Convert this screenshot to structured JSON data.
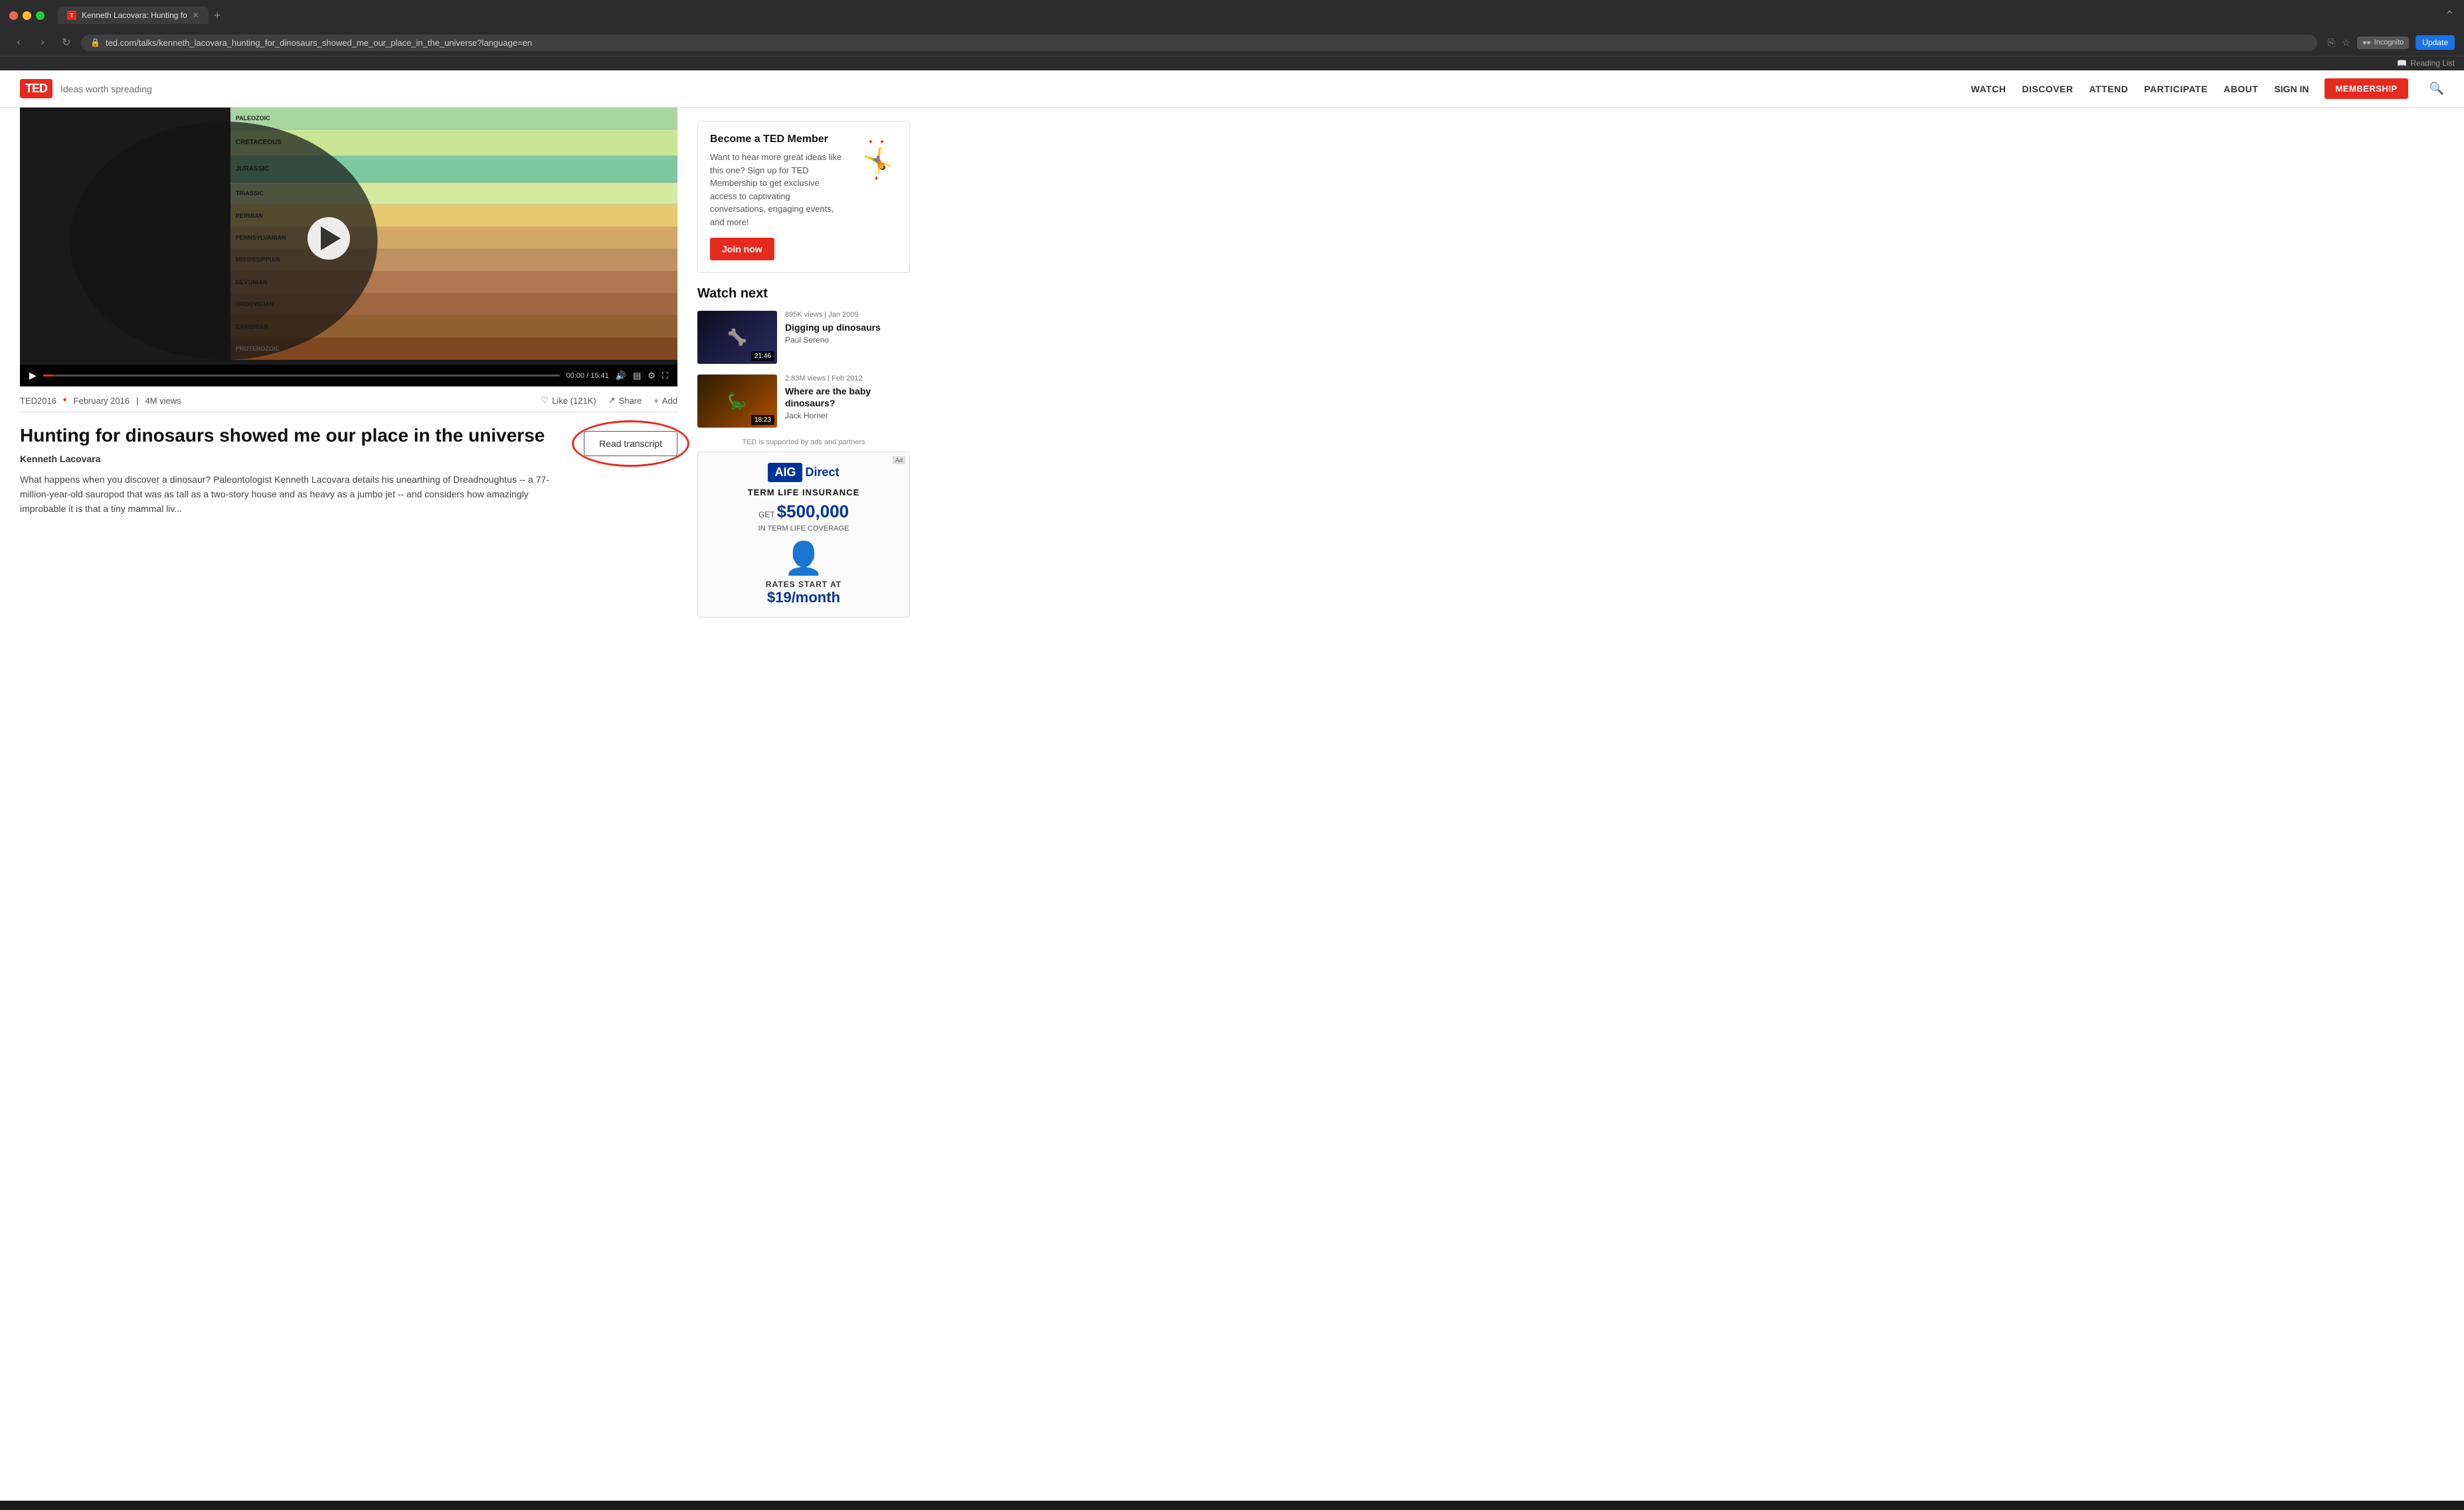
{
  "browser": {
    "tab_title": "Kenneth Lacovara: Hunting fo",
    "url": "ted.com/talks/kenneth_lacovara_hunting_for_dinosaurs_showed_me_our_place_in_the_universe?language=en",
    "incognito_label": "Incognito",
    "update_label": "Update",
    "reading_list_label": "Reading List"
  },
  "header": {
    "logo": "TED",
    "tagline": "Ideas worth spreading",
    "nav": {
      "watch": "WATCH",
      "discover": "DISCOVER",
      "attend": "ATTEND",
      "participate": "PARTICIPATE",
      "about": "ABOUT",
      "signin": "SIGN IN",
      "membership": "MEMBERSHIP"
    }
  },
  "video": {
    "progress": "00:00 / 15:41"
  },
  "talk_meta": {
    "event": "TED2016",
    "date": "February 2016",
    "views": "4M views",
    "like_label": "Like (121K)",
    "share_label": "Share",
    "add_label": "Add"
  },
  "talk": {
    "title": "Hunting for dinosaurs showed me our place in the universe",
    "speaker": "Kenneth Lacovara",
    "summary": "What happens when you discover a dinosaur? Paleontologist Kenneth Lacovara details his unearthing of Dreadnoughtus -- a 77-million-year-old sauropod that was as tall as a two-story house and as heavy as a jumbo jet -- and considers how amazingly improbable it is that a tiny mammal liv...",
    "read_transcript_btn": "Read transcript"
  },
  "membership": {
    "title": "Become a TED Member",
    "description": "Want to hear more great ideas like this one? Sign up for TED Membership to get exclusive access to captivating conversations, engaging events, and more!",
    "join_btn": "Join now"
  },
  "watch_next": {
    "title": "Watch next",
    "talks": [
      {
        "meta": "895K views | Jan 2009",
        "title": "Digging up dinosaurs",
        "speaker": "Paul Sereno",
        "duration": "21:46"
      },
      {
        "meta": "2.83M views | Feb 2012",
        "title": "Where are the baby dinosaurs?",
        "speaker": "Jack Horner",
        "duration": "18:23"
      }
    ]
  },
  "ad": {
    "supported_label": "TED is supported by ads and partners",
    "logo_main": "AIG",
    "logo_sub": "Direct",
    "product": "TERM LIFE INSURANCE",
    "coverage_label": "GET",
    "amount": "$500,000",
    "coverage_detail": "IN TERM LIFE COVERAGE",
    "rates_label": "RATES START AT",
    "price": "$19/month"
  }
}
